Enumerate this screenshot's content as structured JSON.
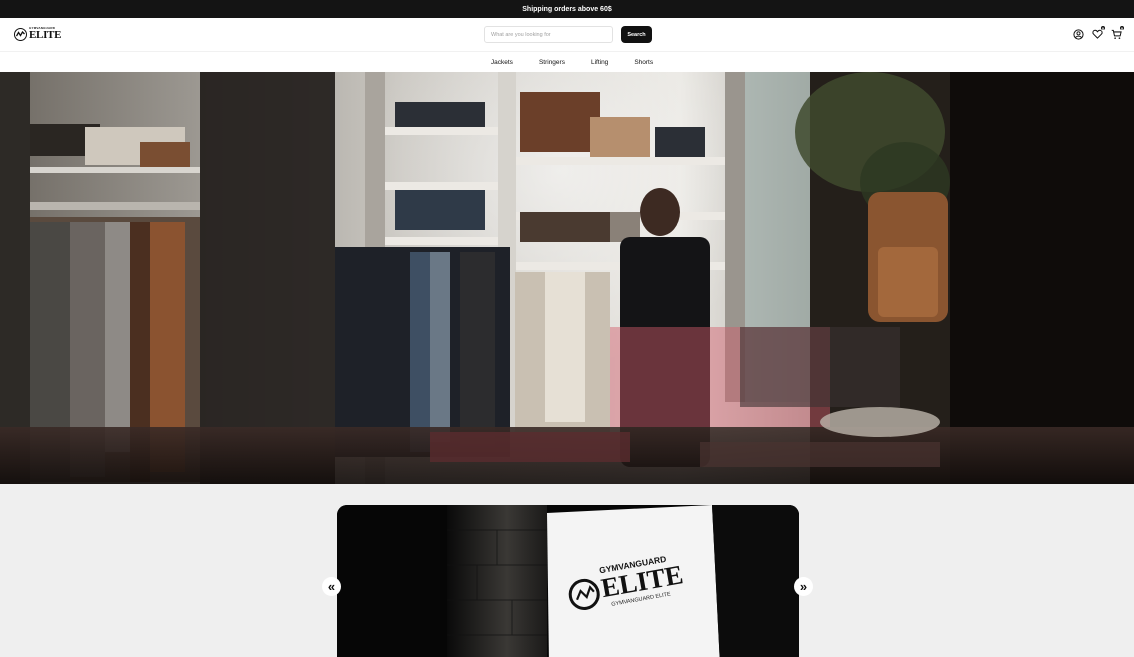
{
  "announcement": "Shipping orders above 60$",
  "logo": {
    "small_text": "GYMVANGUARD",
    "big_text": "ELITE"
  },
  "search": {
    "placeholder": "What are you looking for",
    "value": "",
    "button_label": "Search"
  },
  "header_icons": {
    "account": "user-circle-icon",
    "wishlist": "heart-icon",
    "wishlist_count": "0",
    "cart": "cart-icon",
    "cart_count": "0"
  },
  "nav": {
    "items": [
      {
        "label": "Jackets"
      },
      {
        "label": "Stringers"
      },
      {
        "label": "Lifting"
      },
      {
        "label": "Shorts"
      }
    ]
  },
  "carousel": {
    "prev_label": "«",
    "next_label": "»",
    "slide_logo": {
      "top_text": "GYMVANGUARD",
      "big_text": "ELITE",
      "bottom_text": "GYMVANGUARD ELITE"
    }
  },
  "colors": {
    "topbar": "#141414",
    "accent": "#111111",
    "page_bg": "#efefef"
  }
}
